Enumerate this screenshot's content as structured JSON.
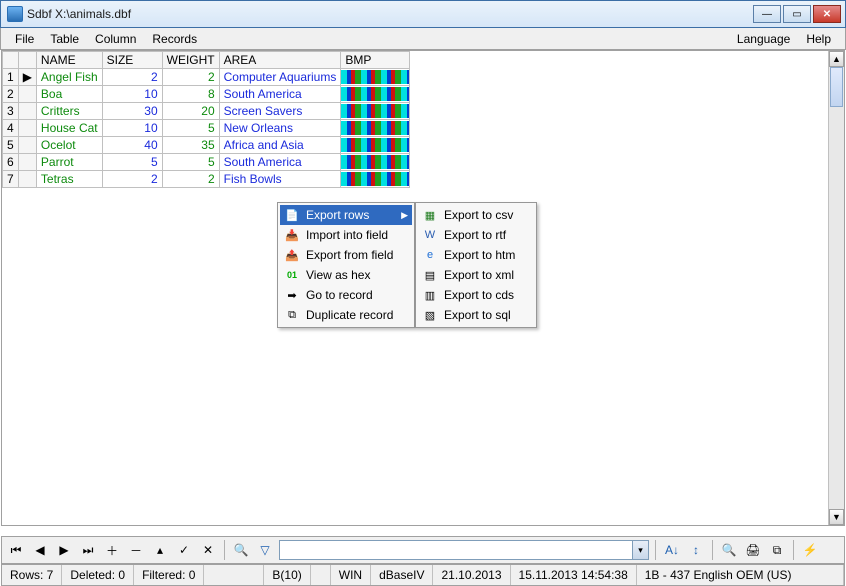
{
  "window": {
    "title": "Sdbf X:\\animals.dbf"
  },
  "menu": {
    "file": "File",
    "table": "Table",
    "column": "Column",
    "records": "Records",
    "language": "Language",
    "help": "Help"
  },
  "columns": {
    "name": "NAME",
    "size": "SIZE",
    "weight": "WEIGHT",
    "area": "AREA",
    "bmp": "BMP"
  },
  "rows": [
    {
      "n": "1",
      "name": "Angel Fish",
      "size": "2",
      "weight": "2",
      "area": "Computer Aquariums"
    },
    {
      "n": "2",
      "name": "Boa",
      "size": "10",
      "weight": "8",
      "area": "South America"
    },
    {
      "n": "3",
      "name": "Critters",
      "size": "30",
      "weight": "20",
      "area": "Screen Savers"
    },
    {
      "n": "4",
      "name": "House Cat",
      "size": "10",
      "weight": "5",
      "area": "New Orleans"
    },
    {
      "n": "5",
      "name": "Ocelot",
      "size": "40",
      "weight": "35",
      "area": "Africa and Asia"
    },
    {
      "n": "6",
      "name": "Parrot",
      "size": "5",
      "weight": "5",
      "area": "South America"
    },
    {
      "n": "7",
      "name": "Tetras",
      "size": "2",
      "weight": "2",
      "area": "Fish Bowls"
    }
  ],
  "context_menu": {
    "export_rows": "Export rows",
    "import_field": "Import into field",
    "export_field": "Export from field",
    "view_hex": "View as hex",
    "goto_record": "Go to record",
    "duplicate": "Duplicate record"
  },
  "export_submenu": {
    "csv": "Export to csv",
    "rtf": "Export to rtf",
    "htm": "Export to htm",
    "xml": "Export to xml",
    "cds": "Export to cds",
    "sql": "Export to sql"
  },
  "status": {
    "rows": "Rows: 7",
    "deleted": "Deleted: 0",
    "filtered": "Filtered: 0",
    "btype": "B(10)",
    "enc": "WIN",
    "dbver": "dBaseIV",
    "date1": "21.10.2013",
    "date2": "15.11.2013 14:54:38",
    "codepage": "1B - 437 English OEM (US)"
  }
}
